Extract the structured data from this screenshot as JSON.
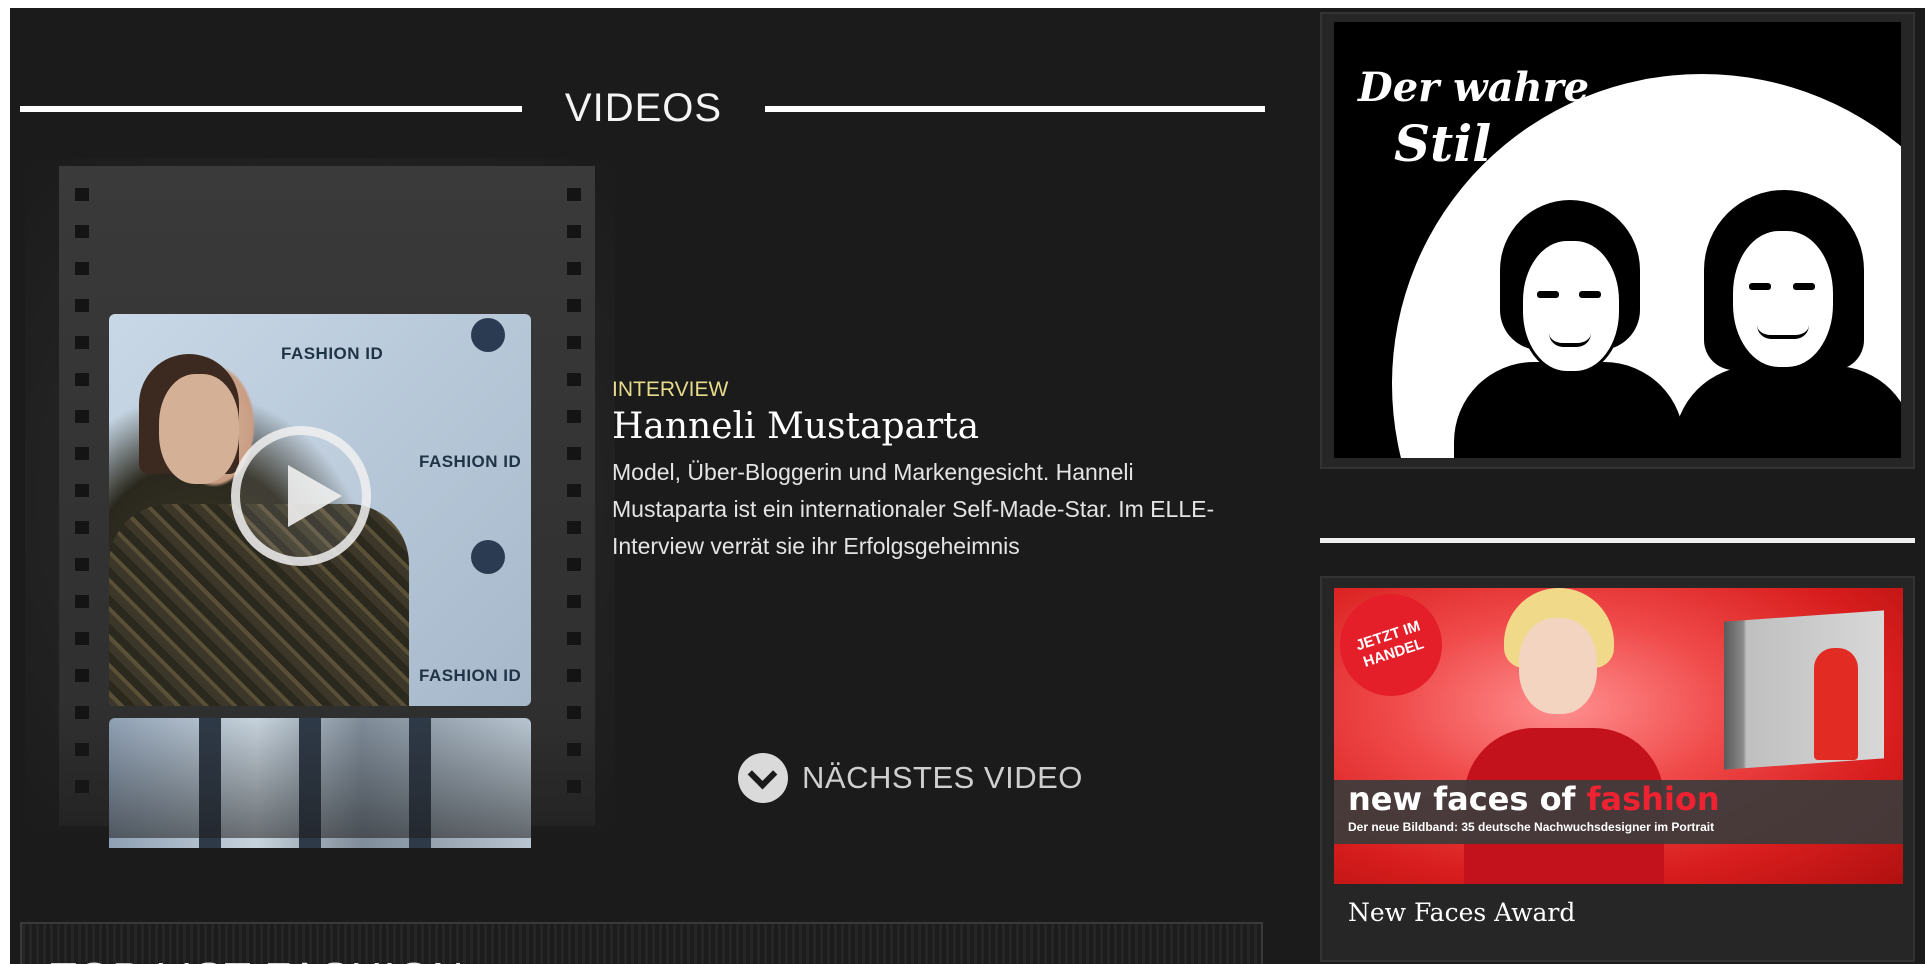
{
  "videos_section": {
    "title": "VIDEOS",
    "featured": {
      "category": "INTERVIEW",
      "title": "Hanneli Mustaparta",
      "description": "Model, Über-Bloggerin und Markengesicht. Hanneli Mustaparta ist ein internationaler Self-Made-Star. Im ELLE-Interview verrät sie ihr Erfolgsgeheimnis",
      "thumbnail_texts": [
        "FASHION ID",
        "FASHION ID",
        "FASHION ID"
      ]
    },
    "next_video_label": "NÄCHSTES VIDEO"
  },
  "top_list": {
    "title": "TOP LIST FASHION"
  },
  "sidebar": {
    "ad1": {
      "line1": "Der wahre",
      "line2": "Stil"
    },
    "ad2": {
      "badge": "JETZT IM HANDEL",
      "headline_white": "new faces of",
      "headline_red": "fashion",
      "subline": "Der neue Bildband: 35 deutsche Nachwuchsdesigner im Portrait",
      "caption": "New Faces Award"
    }
  },
  "colors": {
    "background": "#1b1b1b",
    "category": "#e7dc8c",
    "accent_red": "#ee2230"
  },
  "icons": {
    "play": "play-icon",
    "next": "chevron-down-icon"
  }
}
